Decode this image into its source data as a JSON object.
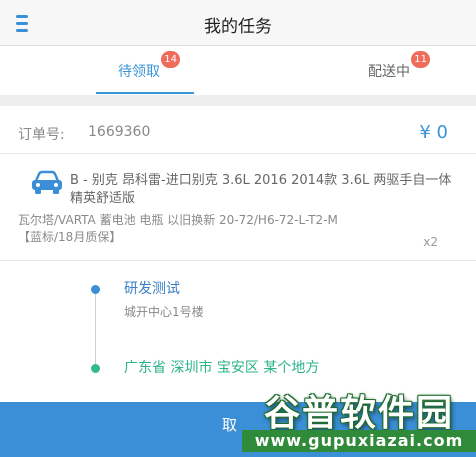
{
  "header": {
    "title": "我的任务",
    "menu_icon": "menu-icon"
  },
  "tabs": [
    {
      "label": "待领取",
      "badge": "14",
      "active": true
    },
    {
      "label": "配送中",
      "badge": "11",
      "active": false
    }
  ],
  "order": {
    "label": "订单号:",
    "number": "1669360",
    "price": "¥ 0"
  },
  "product": {
    "icon": "car-icon",
    "name": "B - 别克 昂科雷-进口别克 3.6L 2016 2014款 3.6L 两驱手自一体 精英舒适版",
    "spec": "瓦尔塔/VARTA 蓄电池 电瓶 以旧换新 20-72/H6-72-L-T2-M【蓝标/18月质保】",
    "quantity": "x2"
  },
  "route": {
    "pickup_title": "研发测试",
    "pickup_address": "城开中心1号楼",
    "dropoff_address": "广东省 深圳市 宝安区 某个地方"
  },
  "action": {
    "button_label": "取"
  },
  "watermark": {
    "title": "谷普软件园",
    "url": "www.gupuxiazai.com"
  },
  "colors": {
    "accent": "#3a8fd6",
    "badge": "#ef6b5a",
    "dropoff": "#33b98a"
  }
}
